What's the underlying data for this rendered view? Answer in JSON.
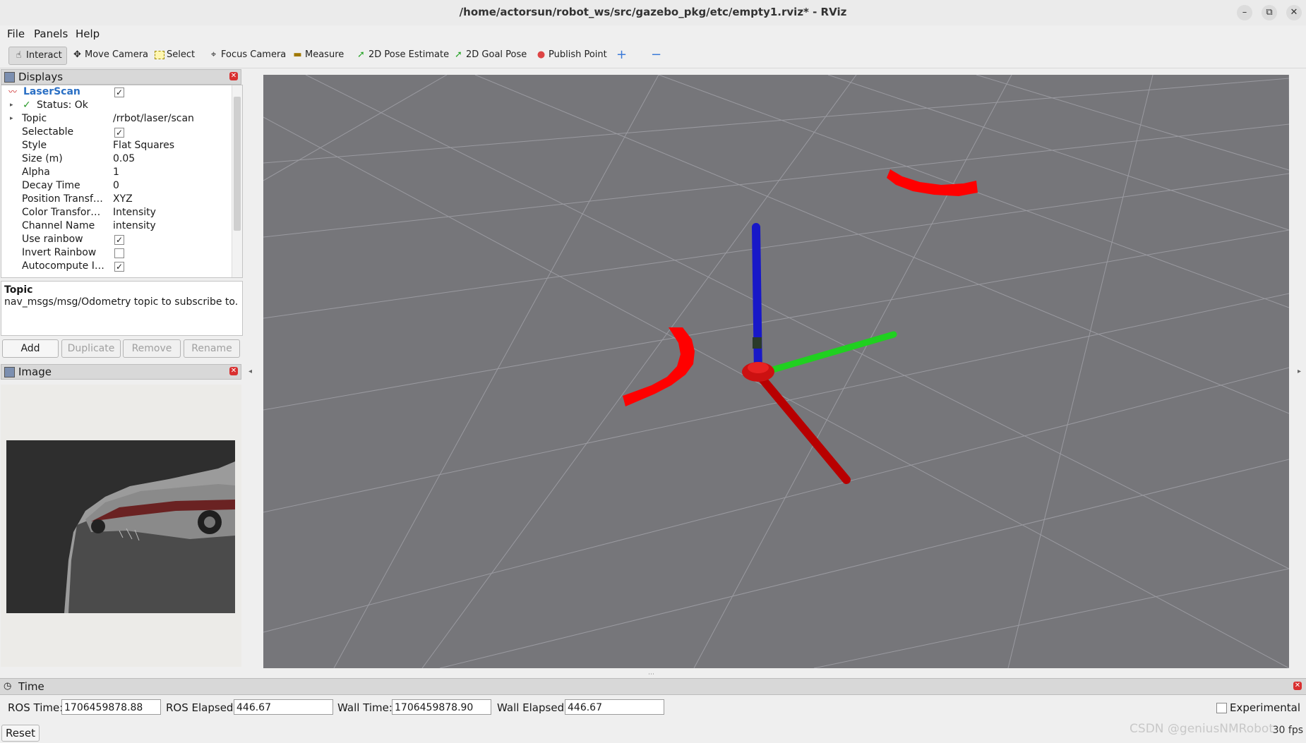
{
  "window": {
    "title": "/home/actorsun/robot_ws/src/gazebo_pkg/etc/empty1.rviz* - RViz",
    "min_glyph": "–",
    "max_glyph": "⧉",
    "close_glyph": "✕"
  },
  "menu": {
    "file": "File",
    "panels": "Panels",
    "help": "Help"
  },
  "toolbar": {
    "interact": "Interact",
    "move_camera": "Move Camera",
    "select": "Select",
    "focus_camera": "Focus Camera",
    "measure": "Measure",
    "pose_estimate": "2D Pose Estimate",
    "goal_pose": "2D Goal Pose",
    "publish_point": "Publish Point",
    "add_tool": "+",
    "remove_tool": "−"
  },
  "displays": {
    "title": "Displays",
    "root_label": "LaserScan",
    "status": "Status: Ok",
    "rows": [
      {
        "key": "Topic",
        "value": "/rrbot/laser/scan"
      },
      {
        "key": "Selectable",
        "value": "✓"
      },
      {
        "key": "Style",
        "value": "Flat Squares"
      },
      {
        "key": "Size (m)",
        "value": "0.05"
      },
      {
        "key": "Alpha",
        "value": "1"
      },
      {
        "key": "Decay Time",
        "value": "0"
      },
      {
        "key": "Position Transf…",
        "value": "XYZ"
      },
      {
        "key": "Color Transfor…",
        "value": "Intensity"
      },
      {
        "key": "Channel Name",
        "value": "intensity"
      },
      {
        "key": "Use rainbow",
        "value": "✓"
      },
      {
        "key": "Invert Rainbow",
        "value": ""
      },
      {
        "key": "Autocompute I…",
        "value": "✓"
      }
    ],
    "desc_title": "Topic",
    "desc_text": "nav_msgs/msg/Odometry topic to subscribe to.",
    "buttons": {
      "add": "Add",
      "duplicate": "Duplicate",
      "remove": "Remove",
      "rename": "Rename"
    }
  },
  "image_panel": {
    "title": "Image"
  },
  "time_panel": {
    "title": "Time",
    "ros_time_label": "ROS Time:",
    "ros_time": "1706459878.88",
    "ros_elapsed_label": "ROS Elapsed:",
    "ros_elapsed": "446.67",
    "wall_time_label": "Wall Time:",
    "wall_time": "1706459878.90",
    "wall_elapsed_label": "Wall Elapsed:",
    "wall_elapsed": "446.67",
    "experimental": "Experimental",
    "reset": "Reset"
  },
  "status": {
    "fps": "30 fps"
  },
  "watermark": "CSDN @geniusNMRobot",
  "colors": {
    "grid_bg": "#76767a",
    "laser": "#ff0000",
    "axis_x": "#cc0000",
    "axis_y": "#22cc22",
    "axis_z": "#1010cc"
  }
}
